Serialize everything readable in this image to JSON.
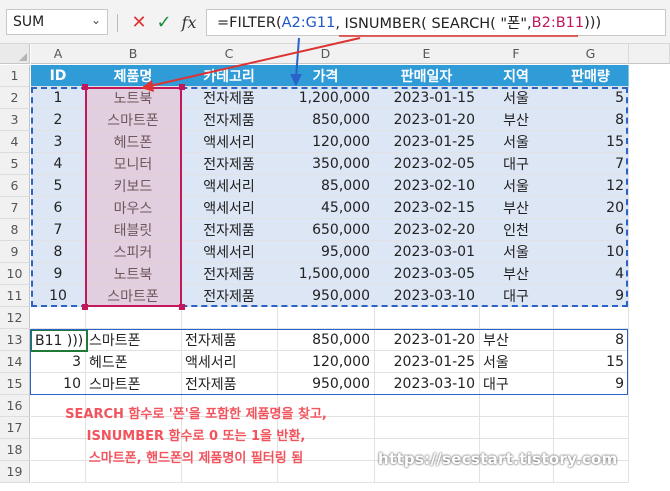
{
  "formula_bar": {
    "name_box": "SUM",
    "cancel_icon": "✕",
    "enter_icon": "✓",
    "fx_label": "fx",
    "formula_parts": [
      "=FILTER( ",
      "A2:G11",
      ", ISNUMBER( SEARCH( \"폰\", ",
      "B2:B11",
      " )))"
    ]
  },
  "columns": [
    "A",
    "B",
    "C",
    "D",
    "E",
    "F",
    "G"
  ],
  "rows": [
    "1",
    "2",
    "3",
    "4",
    "5",
    "6",
    "7",
    "8",
    "9",
    "10",
    "11",
    "12",
    "13",
    "14",
    "15",
    "16",
    "17",
    "18",
    "19"
  ],
  "table": {
    "headers": [
      "ID",
      "제품명",
      "카테고리",
      "가격",
      "판매일자",
      "지역",
      "판매량"
    ],
    "data": [
      [
        "1",
        "노트북",
        "전자제품",
        "1,200,000",
        "2023-01-15",
        "서울",
        "5"
      ],
      [
        "2",
        "스마트폰",
        "전자제품",
        "850,000",
        "2023-01-20",
        "부산",
        "8"
      ],
      [
        "3",
        "헤드폰",
        "액세서리",
        "120,000",
        "2023-01-25",
        "서울",
        "15"
      ],
      [
        "4",
        "모니터",
        "전자제품",
        "350,000",
        "2023-02-05",
        "대구",
        "7"
      ],
      [
        "5",
        "키보드",
        "액세서리",
        "85,000",
        "2023-02-10",
        "서울",
        "12"
      ],
      [
        "6",
        "마우스",
        "액세서리",
        "45,000",
        "2023-02-15",
        "부산",
        "20"
      ],
      [
        "7",
        "태블릿",
        "전자제품",
        "650,000",
        "2023-02-20",
        "인천",
        "6"
      ],
      [
        "8",
        "스피커",
        "액세서리",
        "95,000",
        "2023-03-01",
        "서울",
        "10"
      ],
      [
        "9",
        "노트북",
        "전자제품",
        "1,500,000",
        "2023-03-05",
        "부산",
        "4"
      ],
      [
        "10",
        "스마트폰",
        "전자제품",
        "950,000",
        "2023-03-10",
        "대구",
        "9"
      ]
    ]
  },
  "result": {
    "active_cell_text": "B11 )))",
    "rows": [
      [
        "",
        "스마트폰",
        "전자제품",
        "850,000",
        "2023-01-20",
        "부산",
        "8"
      ],
      [
        "3",
        "헤드폰",
        "액세서리",
        "120,000",
        "2023-01-25",
        "서울",
        "15"
      ],
      [
        "10",
        "스마트폰",
        "전자제품",
        "950,000",
        "2023-03-10",
        "대구",
        "9"
      ]
    ]
  },
  "annotation": {
    "lines": [
      "SEARCH 함수로 '폰'을 포함한 제품명을 찾고,",
      "ISNUMBER 함수로 0 또는 1을 반환,",
      "스마트폰, 핸드폰의 제품명이 필터링 됨"
    ],
    "url": "https://secstart.tistory.com"
  },
  "colors": {
    "header_fill": "#2f9bd7",
    "data_fill": "#dce6f4",
    "range_blue": "#2a62c7",
    "range_pink": "#c2185b",
    "note_red": "#f2545e"
  }
}
